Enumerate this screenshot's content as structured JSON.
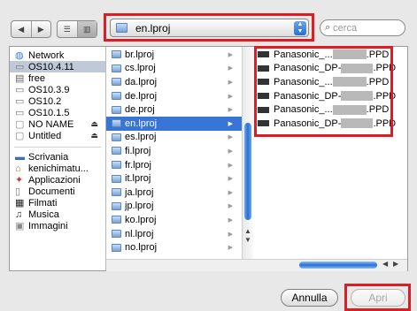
{
  "toolbar": {
    "back_icon": "back-arrow",
    "forward_icon": "forward-arrow",
    "list_view_icon": "list-view",
    "column_view_icon": "column-view",
    "location": "en.lproj",
    "search_placeholder": "cerca"
  },
  "sidebar": {
    "devices": [
      {
        "label": "Network",
        "icon": "network-globe-icon"
      },
      {
        "label": "OS10.4.11",
        "icon": "hard-disk-icon",
        "selected": true
      },
      {
        "label": "free",
        "icon": "document-icon"
      },
      {
        "label": "OS10.3.9",
        "icon": "hard-disk-icon"
      },
      {
        "label": "OS10.2",
        "icon": "hard-disk-icon"
      },
      {
        "label": "OS10.1.5",
        "icon": "hard-disk-icon"
      },
      {
        "label": "NO NAME",
        "icon": "blank-disk-icon",
        "eject": true
      },
      {
        "label": "Untitled",
        "icon": "blank-disk-icon",
        "eject": true
      }
    ],
    "places": [
      {
        "label": "Scrivania",
        "icon": "desktop-icon"
      },
      {
        "label": "kenichimatu...",
        "icon": "home-icon"
      },
      {
        "label": "Applicazioni",
        "icon": "applications-icon"
      },
      {
        "label": "Documenti",
        "icon": "documents-icon"
      },
      {
        "label": "Filmati",
        "icon": "movies-icon"
      },
      {
        "label": "Musica",
        "icon": "music-icon"
      },
      {
        "label": "Immagini",
        "icon": "pictures-icon"
      }
    ]
  },
  "folders": [
    {
      "label": "br.lproj"
    },
    {
      "label": "cs.lproj"
    },
    {
      "label": "da.lproj"
    },
    {
      "label": "de.lproj"
    },
    {
      "label": "de.proj"
    },
    {
      "label": "en.lproj",
      "selected": true
    },
    {
      "label": "es.lproj"
    },
    {
      "label": "fi.lproj"
    },
    {
      "label": "fr.lproj"
    },
    {
      "label": "it.lproj"
    },
    {
      "label": "ja.lproj"
    },
    {
      "label": "jp.lproj"
    },
    {
      "label": "ko.lproj"
    },
    {
      "label": "nl.lproj"
    },
    {
      "label": "no.lproj"
    }
  ],
  "files": [
    {
      "prefix": "Panasonic_...",
      "suffix": ".PPD"
    },
    {
      "prefix": "Panasonic_DP-",
      "suffix": ".PPD"
    },
    {
      "prefix": "Panasonic_...",
      "suffix": ".PPD"
    },
    {
      "prefix": "Panasonic_DP-",
      "suffix": ".PPD"
    },
    {
      "prefix": "Panasonic_...",
      "suffix": ".PPD"
    },
    {
      "prefix": "Panasonic_DP-",
      "suffix": ".PPD"
    }
  ],
  "buttons": {
    "cancel": "Annulla",
    "open": "Apri"
  },
  "colors": {
    "highlight_box": "#e01b22",
    "selection": "#3875d7"
  }
}
